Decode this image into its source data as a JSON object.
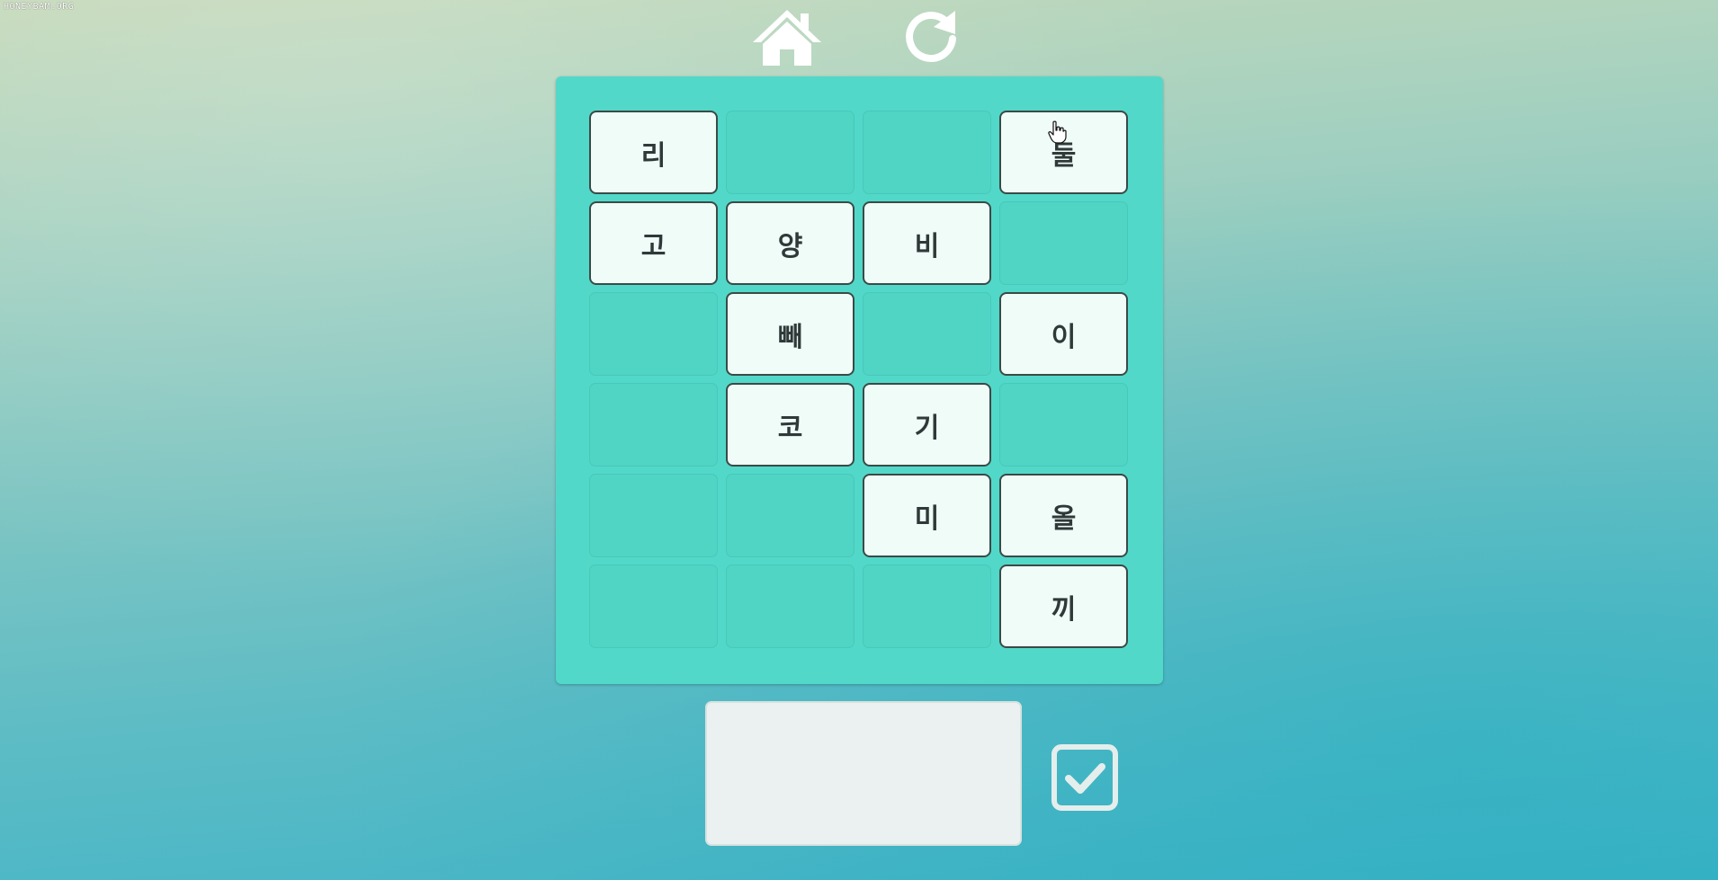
{
  "watermark": "HONEYBAM.ORG",
  "icons": {
    "home": "home-icon",
    "restart": "restart-icon",
    "submit": "checkbox-check-icon",
    "cursor": "hand-pointer-cursor"
  },
  "colors": {
    "board": "#52d8c8",
    "tile": "#effcf8",
    "tile_border": "#3a4a47",
    "tile_text": "#2f3a38",
    "answer_box": "#ebf1f0",
    "control_icon": "#ffffff"
  },
  "grid": {
    "rows": [
      [
        "리",
        "",
        "",
        "둘"
      ],
      [
        "고",
        "양",
        "비",
        ""
      ],
      [
        "",
        "빼",
        "",
        "이"
      ],
      [
        "",
        "코",
        "기",
        ""
      ],
      [
        "",
        "",
        "미",
        "올"
      ],
      [
        "",
        "",
        "",
        "끼"
      ]
    ]
  },
  "answer": {
    "value": ""
  }
}
